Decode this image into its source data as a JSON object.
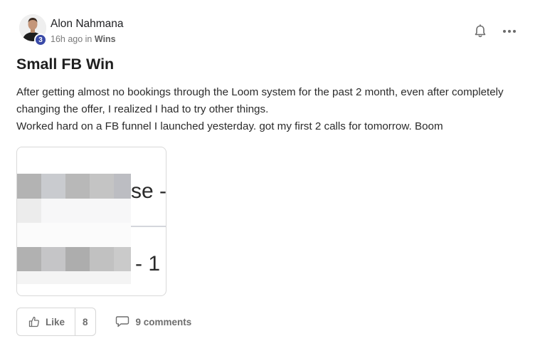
{
  "post": {
    "author": {
      "name": "Alon Nahmana",
      "level": "3"
    },
    "meta": {
      "time": "16h ago in",
      "category": "Wins"
    },
    "title": "Small FB Win",
    "body": [
      "After getting almost no bookings through the Loom system for the past 2 month, even after completely changing the offer, I realized I had to try other things.",
      "Worked hard on a FB funnel I launched yesterday. got my first 2 calls for tomorrow. Boom"
    ],
    "attachment": {
      "visible_text_top": "se -",
      "visible_text_bottom": "- 1"
    },
    "actions": {
      "like_label": "Like",
      "like_count": "8",
      "comments_label": "9 comments"
    }
  },
  "icons": {
    "bell": "bell-icon",
    "more": "more-horizontal-icon",
    "like": "thumbs-up-icon",
    "comment": "comment-icon"
  },
  "colors": {
    "level_badge": "#3a4aa8",
    "muted_text": "#6e6e6e",
    "border": "#d6d6d6"
  }
}
